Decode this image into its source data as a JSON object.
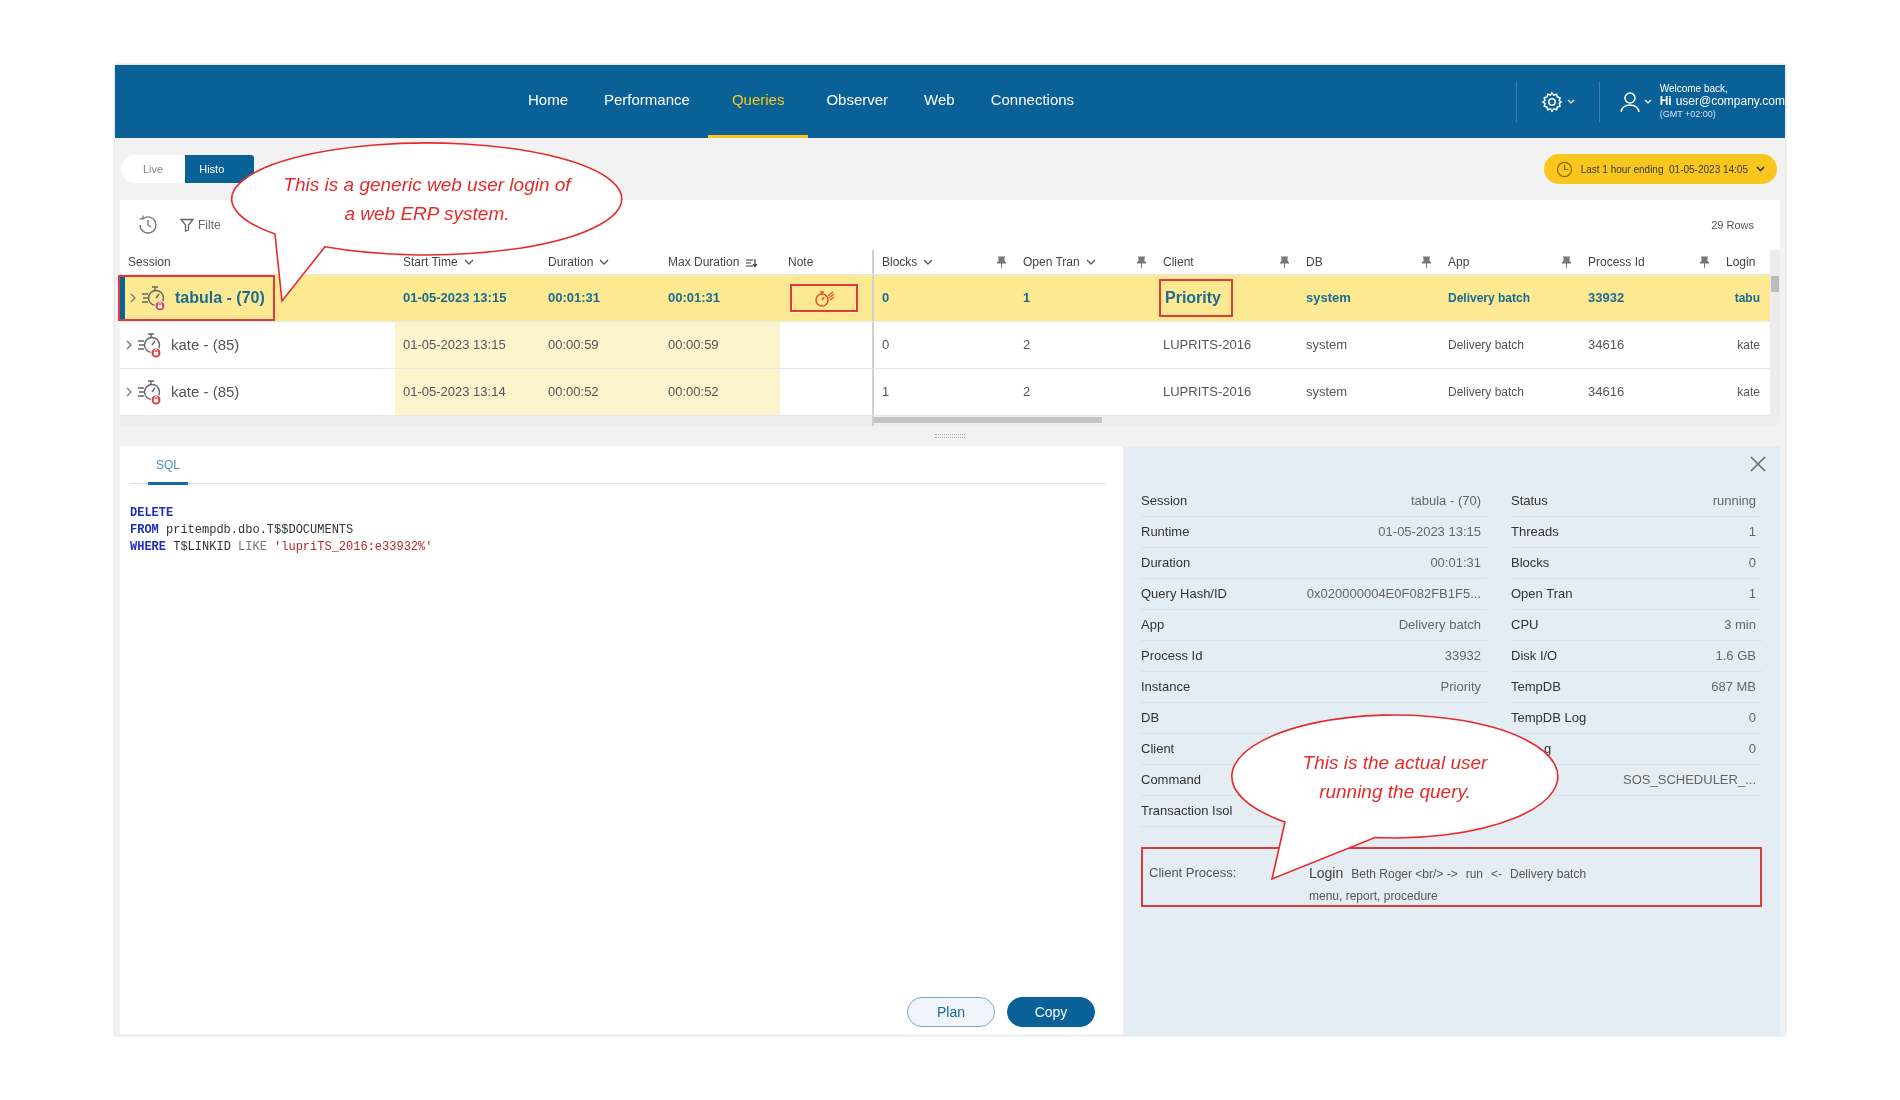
{
  "nav": {
    "items": [
      {
        "label": "Home",
        "selected": false
      },
      {
        "label": "Performance",
        "selected": false
      },
      {
        "label": "Queries",
        "selected": true
      },
      {
        "label": "Observer",
        "selected": false
      },
      {
        "label": "Web",
        "selected": false
      },
      {
        "label": "Connections",
        "selected": false
      }
    ],
    "user": {
      "greeting": "Welcome back,",
      "hi": "Hi",
      "email": "user@company.com",
      "timezone": "(GMT +02:00)"
    }
  },
  "mode_tabs": [
    {
      "label": "Live",
      "selected": false
    },
    {
      "label": "Histo",
      "selected": true
    }
  ],
  "time_range": "Last 1 hour ending  01-05-2023 14:05",
  "toolbar": {
    "filter": "Filte",
    "row_count": "29 Rows"
  },
  "table": {
    "columns": [
      {
        "label": "Session"
      },
      {
        "label": "Start Time",
        "menu": true,
        "shaded": true
      },
      {
        "label": "Duration",
        "menu": true,
        "shaded": true
      },
      {
        "label": "Max Duration",
        "sorted": true,
        "shaded": true
      },
      {
        "label": "Note"
      },
      {
        "label": "Blocks",
        "menu": true,
        "pinned": true
      },
      {
        "label": "Open Tran",
        "menu": true,
        "pinned": true
      },
      {
        "label": "Client",
        "pinned": true
      },
      {
        "label": "DB",
        "pinned": true
      },
      {
        "label": "App",
        "pinned": true
      },
      {
        "label": "Process Id",
        "pinned": true
      },
      {
        "label": "Login"
      }
    ],
    "rows": [
      {
        "selected": true,
        "session": "tabula - (70)",
        "session_annotated": true,
        "start": "01-05-2023 13:15",
        "duration": "00:01:31",
        "max_duration": "00:01:31",
        "note": true,
        "note_annotated": true,
        "blocks": "0",
        "open_tran": "1",
        "client": "Priority",
        "client_annotated": true,
        "db": "system",
        "app": "Delivery batch",
        "process_id": "33932",
        "login": "tabu"
      },
      {
        "selected": false,
        "session": "kate - (85)",
        "session_annotated": false,
        "start": "01-05-2023 13:15",
        "duration": "00:00:59",
        "max_duration": "00:00:59",
        "note": false,
        "blocks": "0",
        "open_tran": "2",
        "client": "LUPRITS-2016",
        "client_annotated": false,
        "db": "system",
        "app": "Delivery batch",
        "process_id": "34616",
        "login": "kate"
      },
      {
        "selected": false,
        "session": "kate - (85)",
        "session_annotated": false,
        "start": "01-05-2023 13:14",
        "duration": "00:00:52",
        "max_duration": "00:00:52",
        "note": false,
        "blocks": "1",
        "open_tran": "2",
        "client": "LUPRITS-2016",
        "client_annotated": false,
        "db": "system",
        "app": "Delivery batch",
        "process_id": "34616",
        "login": "kate"
      }
    ]
  },
  "sql": {
    "tab": "SQL",
    "lines": [
      [
        {
          "kind": "keyword",
          "text": "DELETE"
        }
      ],
      [
        {
          "kind": "keyword",
          "text": "FROM"
        },
        {
          "kind": "plain",
          "text": " pritempdb.dbo.T$$DOCUMENTS"
        }
      ],
      [
        {
          "kind": "keyword",
          "text": "WHERE"
        },
        {
          "kind": "plain",
          "text": " T$LINKID "
        },
        {
          "kind": "operator",
          "text": "LIKE"
        },
        {
          "kind": "string",
          "text": " 'lupriTS_2016:e33932%'"
        }
      ]
    ]
  },
  "details": {
    "left": [
      {
        "label": "Session",
        "value": "tabula - (70)"
      },
      {
        "label": "Runtime",
        "value": "01-05-2023 13:15"
      },
      {
        "label": "Duration",
        "value": "00:01:31"
      },
      {
        "label": "Query Hash/ID",
        "value": "0x020000004E0F082FB1F5..."
      },
      {
        "label": "App",
        "value": "Delivery batch"
      },
      {
        "label": "Process Id",
        "value": "33932"
      },
      {
        "label": "Instance",
        "value": "Priority"
      },
      {
        "label": "DB"
      },
      {
        "label": "Client"
      },
      {
        "label": "Command"
      },
      {
        "label": "Transaction Isol"
      }
    ],
    "right": [
      {
        "kind": "plain",
        "label": "Status",
        "value": "running"
      },
      {
        "kind": "plain",
        "label": "Threads",
        "value": "1"
      },
      {
        "kind": "plain",
        "label": "Blocks",
        "value": "0"
      },
      {
        "kind": "plain",
        "label": "Open Tran",
        "value": "1"
      },
      {
        "kind": "plain",
        "label": "CPU",
        "value": "3 min"
      },
      {
        "kind": "plain",
        "label": "Disk I/O",
        "value": "1.6 GB"
      },
      {
        "kind": "plain",
        "label": "TempDB",
        "value": "687 MB"
      },
      {
        "kind": "plain",
        "label": "TempDB Log",
        "value": "0"
      },
      {
        "kind": "covered",
        "label": "g",
        "value": "0"
      },
      {
        "kind": "plain",
        "value": "SOS_SCHEDULER_..."
      }
    ]
  },
  "client_process": {
    "label": "Client Process:",
    "annotated": true,
    "parts": [
      "Login",
      "Beth Roger <br/> ->",
      "run",
      "<-",
      "Delivery batch"
    ],
    "second_line": "menu, report, procedure"
  },
  "buttons": [
    {
      "label": "Plan",
      "kind": "secondary"
    },
    {
      "label": "Copy",
      "kind": "primary"
    }
  ],
  "callouts": [
    {
      "text": "This is a generic web user login of a web ERP system."
    },
    {
      "text": "This is the actual user running the query."
    }
  ]
}
